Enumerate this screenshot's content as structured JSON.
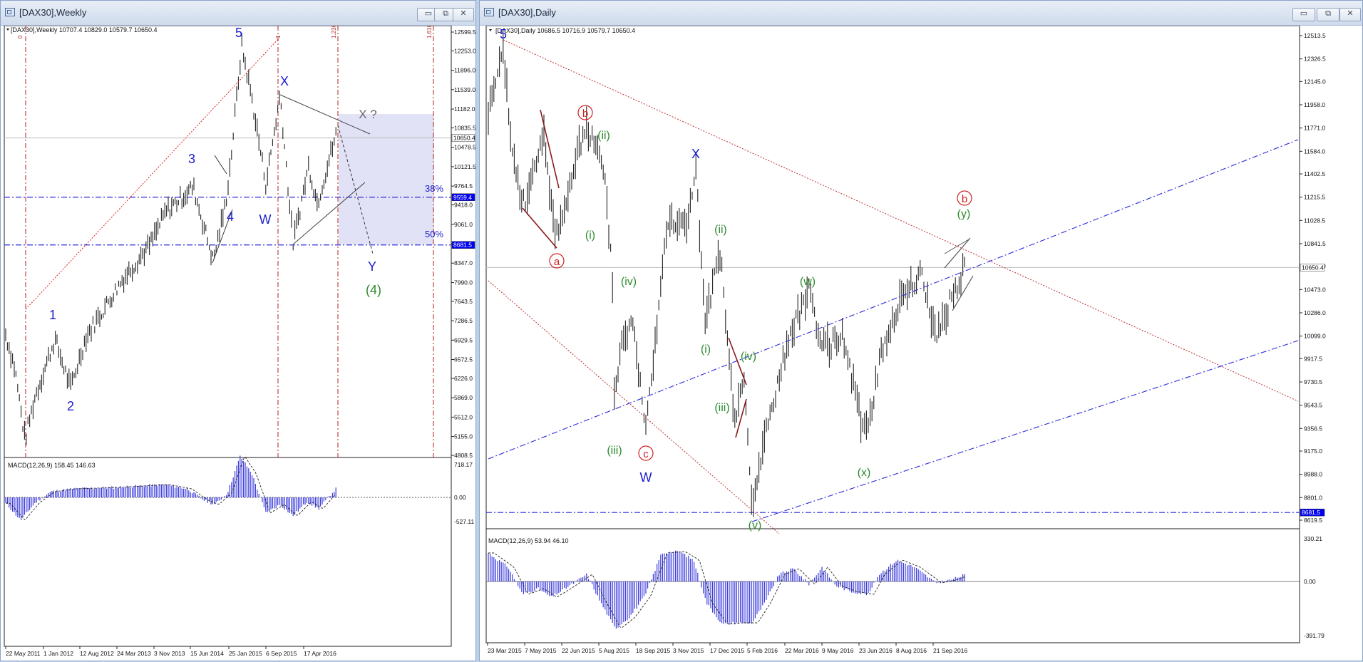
{
  "left": {
    "title": "[DAX30],Weekly",
    "info": "[DAX30],Weekly  10707.4 10829.0 10579.7 10650.4",
    "price_ticks": [
      "12599.5",
      "12253.0",
      "11896.0",
      "11539.0",
      "11182.0",
      "10835.5",
      "10478.5",
      "10121.5",
      "9764.5",
      "9418.0",
      "9061.0",
      "8704.0",
      "8347.0",
      "7990.0",
      "7643.5",
      "7286.5",
      "6929.5",
      "6572.5",
      "6226.0",
      "5869.0",
      "5512.0",
      "5155.0",
      "4808.5"
    ],
    "price_min": 4808.5,
    "price_max": 12599.5,
    "current_price": "10650.4",
    "level_38": "9559.4",
    "level_50": "8681.5",
    "pct_38": "38%",
    "pct_50": "50%",
    "fib_labels": [
      "0",
      "1",
      "1.236",
      "1.618"
    ],
    "wave_labels": {
      "w1": "1",
      "w2": "2",
      "w3": "3",
      "w4": "4",
      "w5": "5",
      "ww": "W",
      "wx": "X",
      "wxq": "X ?",
      "wy": "Y",
      "w4c": "(4)"
    },
    "macd_label": "MACD(12,26,9) 158.45 146.63",
    "macd_ticks": [
      "718.17",
      "0.00",
      "-527.11"
    ],
    "date_labels": [
      "22 May 2011",
      "1 Jan 2012",
      "12 Aug 2012",
      "24 Mar 2013",
      "3 Nov 2013",
      "15 Jun 2014",
      "25 Jan 2015",
      "6 Sep 2015",
      "17 Apr 2016"
    ]
  },
  "right": {
    "title": "[DAX30],Daily",
    "info": "[DAX30],Daily  10686.5 10716.9 10579.7 10650.4",
    "price_ticks": [
      "12513.5",
      "12326.5",
      "12145.0",
      "11958.0",
      "11771.0",
      "11584.0",
      "11402.5",
      "11215.5",
      "11028.5",
      "10841.5",
      "10660.0",
      "10473.0",
      "10286.0",
      "10099.0",
      "9917.5",
      "9730.5",
      "9543.5",
      "9356.5",
      "9175.0",
      "8988.0",
      "8801.0",
      "8619.5"
    ],
    "price_min": 8619.5,
    "price_max": 12513.5,
    "current_price": "10650.4",
    "level": "8681.5",
    "wave_labels": {
      "w5": "5",
      "wx": "X",
      "ww": "W",
      "ra": "a",
      "rb": "b",
      "rc": "c",
      "rb2": "b",
      "gy": "(y)",
      "gi1": "(i)",
      "gii1": "(ii)",
      "giii1": "(iii)",
      "giv1": "(iv)",
      "gii2": "(ii)",
      "gi2": "(i)",
      "giii2": "(iii)",
      "giv2": "(iv)",
      "gv": "(v)",
      "gw": "(w)",
      "gx": "(x)"
    },
    "macd_label": "MACD(12,26,9) 53.94 46.10",
    "macd_ticks": [
      "330.21",
      "0.00",
      "-391.79"
    ],
    "date_labels": [
      "23 Mar 2015",
      "7 May 2015",
      "22 Jun 2015",
      "5 Aug 2015",
      "18 Sep 2015",
      "3 Nov 2015",
      "17 Dec 2015",
      "5 Feb 2016",
      "22 Mar 2016",
      "9 May 2016",
      "23 Jun 2016",
      "8 Aug 2016",
      "21 Sep 2016"
    ]
  },
  "buttons": {
    "min": "▭",
    "restore": "⧉",
    "close": "✕"
  },
  "colors": {
    "price_bg": "#0000ee",
    "dash_red": "#b22222",
    "blue_line": "#2a2adb",
    "macd": "#3c3cdc",
    "label_blue": "#1c1ccc",
    "label_green": "#2e8b2e",
    "label_red": "#cc2222",
    "zone": "#e2e2f6"
  },
  "chart_data": [
    {
      "type": "line",
      "title": "[DAX30],Weekly",
      "x": [
        "22 May 2011",
        "1 Jan 2012",
        "12 Aug 2012",
        "24 Mar 2013",
        "3 Nov 2013",
        "15 Jun 2014",
        "25 Jan 2015",
        "6 Sep 2015",
        "17 Apr 2016"
      ],
      "series": [
        {
          "name": "",
          "values": [
            6700,
            6000,
            7000,
            7900,
            9200,
            9600,
            11700,
            10000,
            9900
          ]
        }
      ],
      "ylim": [
        4808.5,
        12599.5
      ],
      "grid": false
    },
    {
      "type": "line",
      "title": "[DAX30],Daily",
      "x": [
        "23 Mar 2015",
        "7 May 2015",
        "22 Jun 2015",
        "5 Aug 2015",
        "18 Sep 2015",
        "3 Nov 2015",
        "17 Dec 2015",
        "5 Feb 2016",
        "22 Mar 2016",
        "9 May 2016",
        "23 Jun 2016",
        "8 Aug 2016",
        "21 Sep 2016"
      ],
      "series": [
        {
          "name": "",
          "values": [
            11900,
            11400,
            11300,
            11000,
            9700,
            10900,
            10500,
            9200,
            10000,
            10000,
            9600,
            10500,
            10500
          ]
        }
      ],
      "ylim": [
        8619.5,
        12513.5
      ],
      "grid": false
    }
  ]
}
